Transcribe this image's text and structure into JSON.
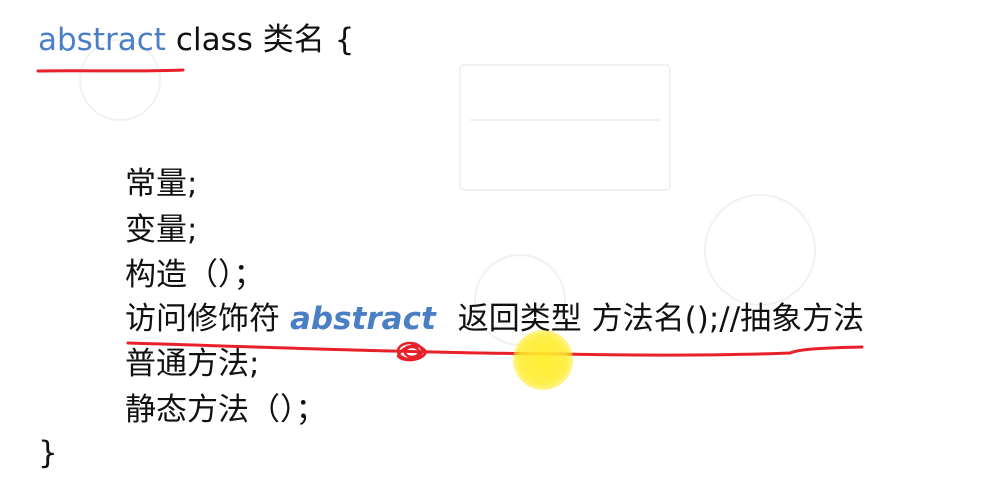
{
  "code": {
    "line1": {
      "keyword": "abstract",
      "rest": "class 类名 {"
    },
    "constants": "常量;",
    "variables": "变量;",
    "constructor": "构造（）；",
    "abstract_method": {
      "prefix": "访问修饰符",
      "keyword": "abstract",
      "suffix": "返回类型 方法名();//抽象方法"
    },
    "normal_method": "普通方法;",
    "static_method": "静态方法（）；",
    "closing_brace": "}"
  },
  "colors": {
    "keyword": "#4a7fc6",
    "annotation_pen": "#e8202a",
    "cursor_highlight": "#ffec28"
  },
  "icons": {
    "cursor": "cursor-highlight-icon"
  }
}
